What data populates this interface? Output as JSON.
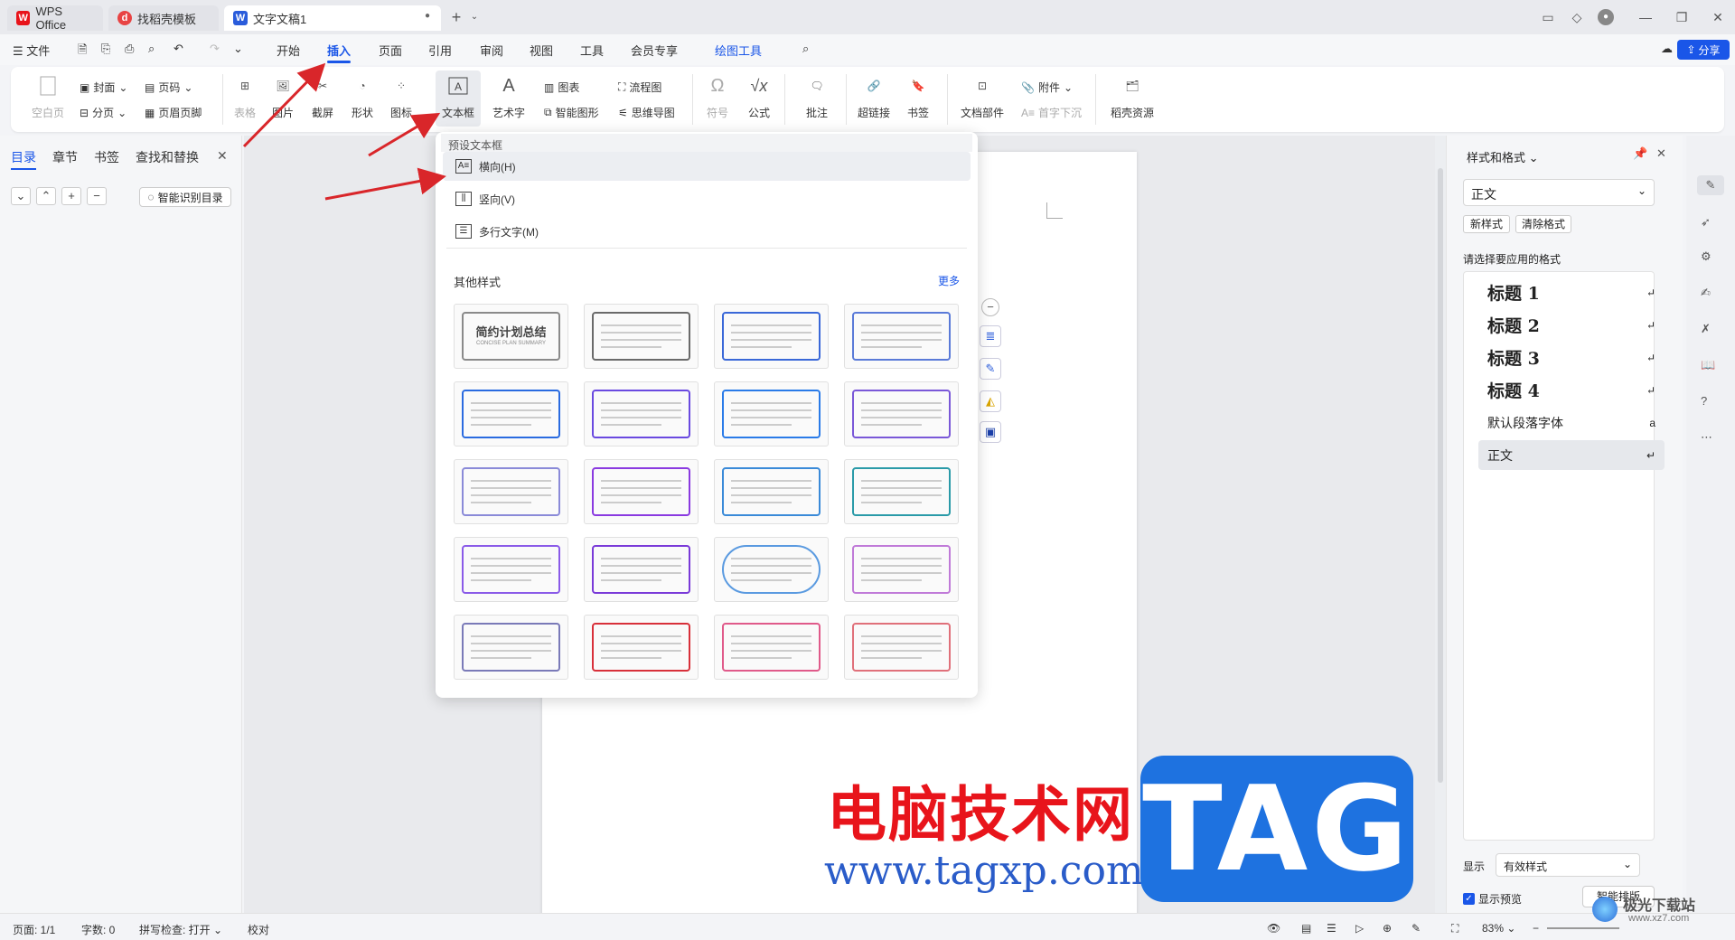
{
  "tabs": [
    {
      "label": "WPS Office",
      "icon": "wps-logo-icon"
    },
    {
      "label": "找稻壳模板",
      "icon": "docer-icon"
    },
    {
      "label": "文字文稿1",
      "icon": "writer-icon"
    }
  ],
  "tab_add": "+",
  "menu": {
    "file": "文件",
    "items": [
      "开始",
      "插入",
      "页面",
      "引用",
      "审阅",
      "视图",
      "工具",
      "会员专享",
      "绘图工具"
    ],
    "active": "插入",
    "share": "分享"
  },
  "ribbon": {
    "blank_page": "空白页",
    "cover": "封面",
    "page_break": "分页",
    "page_num": "页码",
    "header_footer": "页眉页脚",
    "table": "表格",
    "picture": "图片",
    "screenshot": "截屏",
    "shape": "形状",
    "icon": "图标",
    "textbox": "文本框",
    "wordart": "艺术字",
    "chart": "图表",
    "smart_graphic": "智能图形",
    "flowchart": "流程图",
    "mindmap": "思维导图",
    "symbol": "符号",
    "formula": "公式",
    "comment": "批注",
    "hyperlink": "超链接",
    "bookmark": "书签",
    "doc_parts": "文档部件",
    "attachment": "附件",
    "drop_cap": "首字下沉",
    "docer_resources": "稻壳资源"
  },
  "left_panel": {
    "tabs": [
      "目录",
      "章节",
      "书签",
      "查找和替换"
    ],
    "active": "目录",
    "smart_toc": "智能识别目录"
  },
  "dropdown": {
    "section_title": "预设文本框",
    "items": [
      {
        "label": "横向(H)",
        "icon": "horizontal-textbox-icon"
      },
      {
        "label": "竖向(V)",
        "icon": "vertical-textbox-icon"
      },
      {
        "label": "多行文字(M)",
        "icon": "multiline-text-icon"
      }
    ],
    "other_styles": "其他样式",
    "more": "更多",
    "first_thumb_title": "简约计划总结",
    "first_thumb_sub": "CONCISE PLAN SUMMARY",
    "thumb_count": 20
  },
  "right_panel": {
    "title": "样式和格式",
    "current_style": "正文",
    "new_style": "新样式",
    "clear_format": "清除格式",
    "prompt": "请选择要应用的格式",
    "styles": [
      {
        "label": "标题  1",
        "heading": true
      },
      {
        "label": "标题  2",
        "heading": true
      },
      {
        "label": "标题  3",
        "heading": true
      },
      {
        "label": "标题  4",
        "heading": true
      },
      {
        "label": "默认段落字体",
        "heading": false
      },
      {
        "label": "正文",
        "heading": false,
        "selected": true
      }
    ],
    "show_label": "显示",
    "show_value": "有效样式",
    "preview_label": "显示预览",
    "smart_layout": "智能排版"
  },
  "status": {
    "page": "页面: 1/1",
    "words": "字数: 0",
    "spell": "拼写检查: 打开",
    "proof": "校对",
    "zoom": "83%"
  },
  "watermark": {
    "cn": "电脑技术网",
    "url": "www.tagxp.com",
    "tag": "TAG",
    "logo": "极光下载站",
    "logo_url": "www.xz7.com"
  },
  "colors": {
    "accent": "#1a56e8",
    "arrow": "#d9262a",
    "wps_red": "#e8141b",
    "tag_blue": "#1e72e0"
  }
}
